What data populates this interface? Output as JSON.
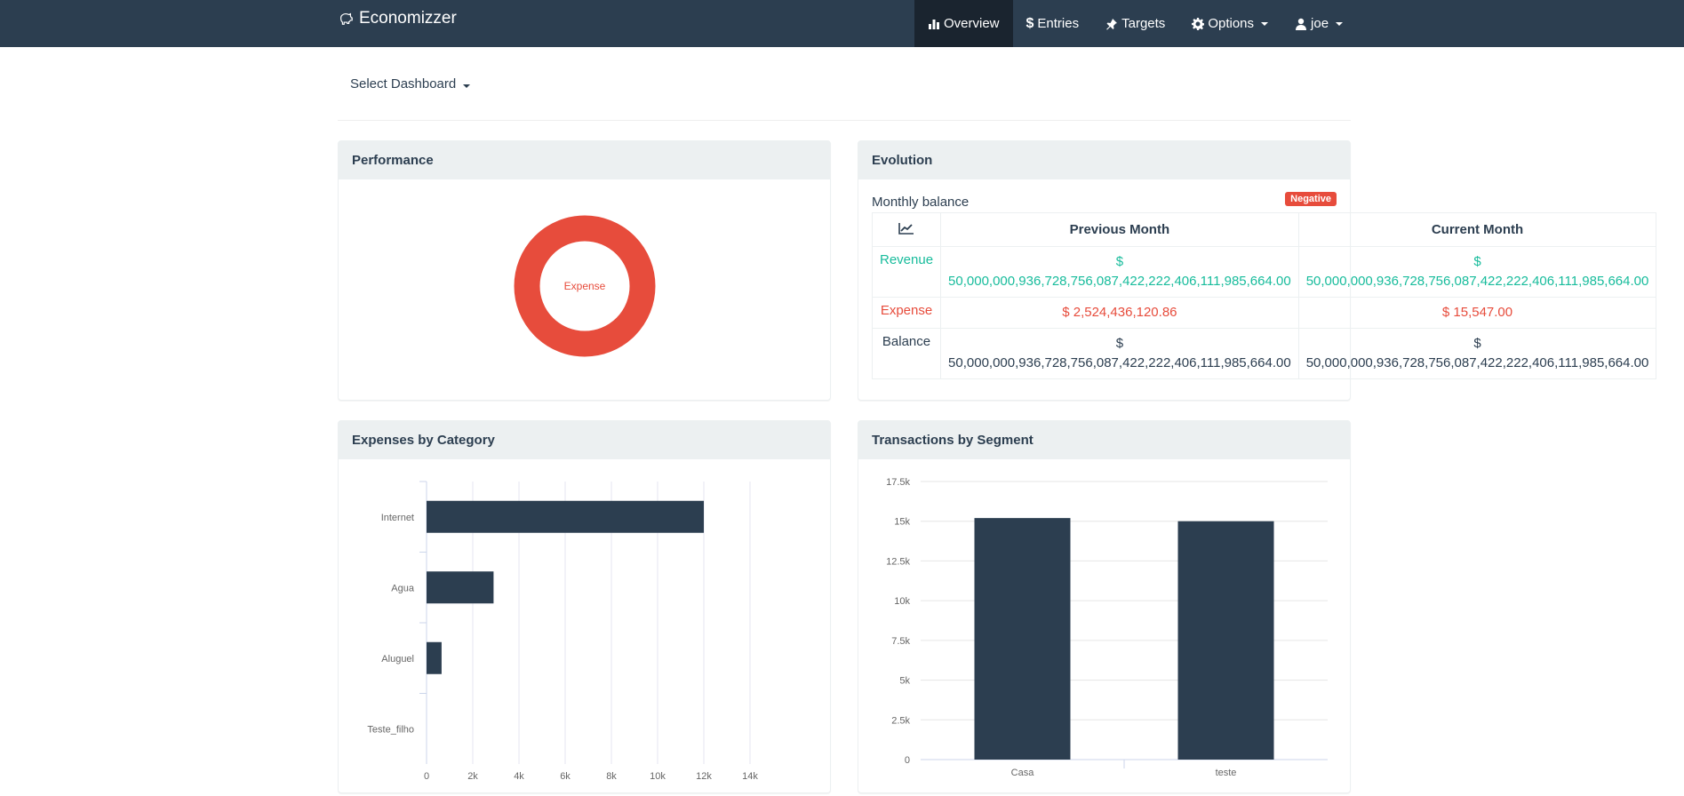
{
  "navbar": {
    "brand": "Economizzer",
    "items": [
      {
        "label": "Overview",
        "icon": "bar-chart-icon",
        "active": true
      },
      {
        "label": "Entries",
        "icon": "dollar-icon"
      },
      {
        "label": "Targets",
        "icon": "pushpin-icon"
      },
      {
        "label": "Options",
        "icon": "gear-icon",
        "dropdown": true
      },
      {
        "label": "joe",
        "icon": "user-icon",
        "dropdown": true
      }
    ]
  },
  "dashboard_select": "Select Dashboard",
  "performance": {
    "title": "Performance",
    "donut_label": "Expense",
    "colors": {
      "expense": "#e74c3c"
    }
  },
  "evolution": {
    "title": "Evolution",
    "subtitle": "Monthly balance",
    "badge": "Negative",
    "columns": [
      "Previous Month",
      "Current Month"
    ],
    "rows": [
      {
        "label": "Revenue",
        "color": "#18bc9c",
        "previous": "$ 50,000,000,936,728,756,087,422,222,406,111,985,664.00",
        "current": "$ 50,000,000,936,728,756,087,422,222,406,111,985,664.00"
      },
      {
        "label": "Expense",
        "color": "#e74c3c",
        "previous": "$ 2,524,436,120.86",
        "current": "$ 15,547.00"
      },
      {
        "label": "Balance",
        "color": "#2c3e50",
        "previous": "$ 50,000,000,936,728,756,087,422,222,406,111,985,664.00",
        "current": "$ 50,000,000,936,728,756,087,422,222,406,111,985,664.00"
      }
    ]
  },
  "expenses_by_category": {
    "title": "Expenses by Category"
  },
  "transactions_by_segment": {
    "title": "Transactions by Segment"
  },
  "chart_data": [
    {
      "type": "bar",
      "orientation": "horizontal",
      "title": "Expenses by Category",
      "categories": [
        "Internet",
        "Agua",
        "Aluguel",
        "Teste_filho"
      ],
      "values": [
        12000,
        2900,
        650,
        0
      ],
      "xlim": [
        0,
        14000
      ],
      "xticks": [
        "0",
        "2k",
        "4k",
        "6k",
        "8k",
        "10k",
        "12k",
        "14k"
      ],
      "xtick_values": [
        0,
        2000,
        4000,
        6000,
        8000,
        10000,
        12000,
        14000
      ],
      "grid": true,
      "color": "#2c3e50"
    },
    {
      "type": "bar",
      "title": "Transactions by Segment",
      "categories": [
        "Casa",
        "teste"
      ],
      "values": [
        15200,
        15000
      ],
      "ylim": [
        0,
        17500
      ],
      "yticks": [
        "0",
        "2.5k",
        "5k",
        "7.5k",
        "10k",
        "12.5k",
        "15k",
        "17.5k"
      ],
      "ytick_values": [
        0,
        2500,
        5000,
        7500,
        10000,
        12500,
        15000,
        17500
      ],
      "grid": true,
      "color": "#2c3e50"
    }
  ]
}
